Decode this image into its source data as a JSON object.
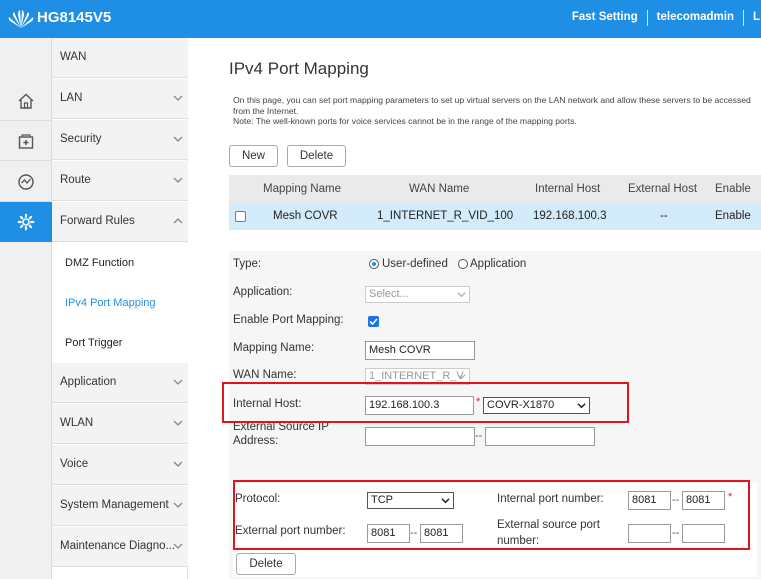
{
  "header": {
    "product": "HG8145V5",
    "fast_setting": "Fast Setting",
    "user": "telecomadmin",
    "logout_partial": "L"
  },
  "icons": [
    "home-icon",
    "add-box-icon",
    "speedometer-icon",
    "gear-icon"
  ],
  "menu": {
    "wan": "WAN",
    "lan": "LAN",
    "security": "Security",
    "route": "Route",
    "forward_rules": "Forward Rules",
    "sub": {
      "dmz": "DMZ Function",
      "ipv4_port_mapping": "IPv4 Port Mapping",
      "port_trigger": "Port Trigger"
    },
    "application": "Application",
    "wlan": "WLAN",
    "voice": "Voice",
    "system_management": "System Management",
    "maintenance": "Maintenance Diagno..."
  },
  "page": {
    "title": "IPv4 Port Mapping",
    "description_1": "On this page, you can set port mapping parameters to set up virtual servers on the LAN network and allow these servers to be accessed from the Internet.",
    "description_2": "Note: The well-known ports for voice services cannot be in the range of the mapping ports.",
    "new_button": "New",
    "delete_button": "Delete"
  },
  "table": {
    "headers": [
      "Mapping Name",
      "WAN Name",
      "Internal Host",
      "External Host",
      "Enable"
    ],
    "rows": [
      [
        "Mesh COVR",
        "1_INTERNET_R_VID_100",
        "192.168.100.3",
        "--",
        "Enable"
      ]
    ]
  },
  "form": {
    "type_label": "Type:",
    "type_option_user": "User-defined",
    "type_option_app": "Application",
    "type_selected": "User-defined",
    "application_label": "Application:",
    "application_value": "Select...",
    "enable_label": "Enable Port Mapping:",
    "enable_checked": true,
    "mapping_name_label": "Mapping Name:",
    "mapping_name_value": "Mesh COVR",
    "wan_name_label": "WAN Name:",
    "wan_name_value": "1_INTERNET_R_V",
    "internal_host_label": "Internal Host:",
    "internal_host_value": "192.168.100.3",
    "internal_host_select": "COVR-X1870",
    "ext_source_ip_label_1": "External Source IP",
    "ext_source_ip_label_2": "Address:",
    "ext_source_ip_from": "",
    "ext_source_ip_to": "",
    "protocol_label": "Protocol:",
    "protocol_value": "TCP",
    "internal_port_label": "Internal port number:",
    "internal_port_from": "8081",
    "internal_port_to": "8081",
    "external_port_label": "External port number:",
    "external_port_from": "8081",
    "external_port_to": "8081",
    "ext_source_port_label_1": "External source port",
    "ext_source_port_label_2": "number:",
    "ext_source_port_from": "",
    "ext_source_port_to": "",
    "dash": "--",
    "required_mark": "*",
    "delete_button": "Delete"
  },
  "colors": {
    "brand_blue": "#1f8fe6",
    "highlight_red": "#e0141e",
    "row_selected": "#d3ebfb"
  }
}
